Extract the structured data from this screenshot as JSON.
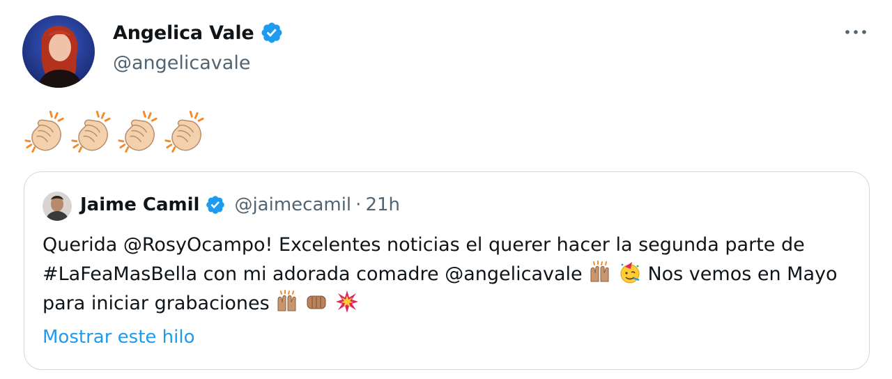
{
  "tweet": {
    "author_name": "Angelica Vale",
    "author_handle": "@angelicavale",
    "body_emojis": [
      "clapping-hands",
      "clapping-hands",
      "clapping-hands",
      "clapping-hands"
    ],
    "more_icon": "more-horizontal-icon"
  },
  "quote": {
    "author_name": "Jaime Camil",
    "author_handle": "@jaimecamil",
    "separator": "·",
    "time": "21h",
    "text_part1": "Querida @RosyOcampo! Excelentes noticias el querer hacer la segunda parte de #LaFeaMasBella con mi adorada comadre @angelicavale",
    "text_part2": " Nos vemos en Mayo para iniciar grabaciones",
    "show_thread": "Mostrar este hilo"
  },
  "colors": {
    "accent": "#1d9bf0",
    "secondary_text": "#536471",
    "border": "#cfd9de"
  }
}
